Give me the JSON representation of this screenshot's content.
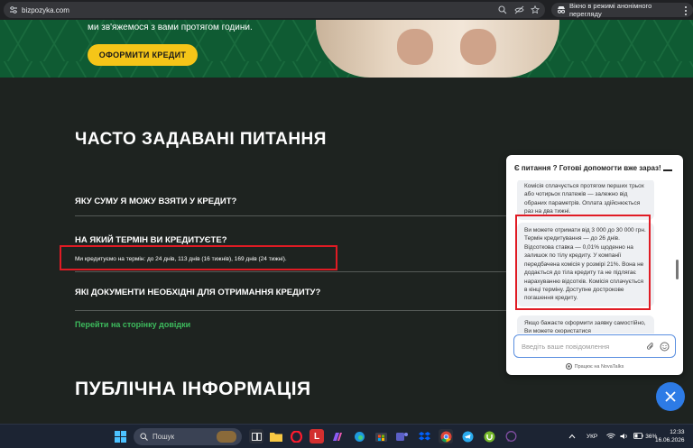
{
  "browser": {
    "url": "bizpozyka.com",
    "incognito_label": "Вікно в режимі анонімного перегляду"
  },
  "hero": {
    "text": "ми зв'яжемося з вами протягом години.",
    "cta_label": "ОФОРМИТИ КРЕДИТ"
  },
  "faq": {
    "title": "ЧАСТО ЗАДАВАНІ ПИТАННЯ",
    "questions": [
      {
        "label": "ЯКУ СУМУ Я МОЖУ ВЗЯТИ У КРЕДИТ?"
      },
      {
        "label": "НА ЯКИЙ ТЕРМІН ВИ КРЕДИТУЄТЕ?",
        "answer": "Ми кредитуємо на термін: до 24 днів, 113 днів (16 тижнів), 169 днів (24 тижні)."
      },
      {
        "label": "ЯКІ ДОКУМЕНТИ НЕОБХІДНІ ДЛЯ ОТРИМАННЯ КРЕДИТУ?"
      }
    ],
    "help_link": "Перейти на сторінку довідки"
  },
  "public_info": {
    "title": "ПУБЛІЧНА ІНФОРМАЦІЯ"
  },
  "chat": {
    "header": "Є питання ? Готові допомогти вже зараз!",
    "messages": [
      "Комісія сплачується протягом перших трьох або чотирьох платежів — залежно від обраних параметрів. Оплата здійснюється раз на два тижні.",
      "Ви можете отримати від 3 000 до 30 000 грн. Термін кредитування — до 26 днів. Відсоткова ставка — 0,01% щоденно на залишок по тілу кредиту. У компанії передбачена комісія у розмірі 21%. Вона не додається до тіла кредиту та не підлягає нарахуванню відсотків. Комісія сплачується в кінці терміну. Доступне дострокове погашення кредиту.",
      "Якщо бажаєте оформити заявку самостійно, Ви можете скористатися"
    ],
    "input_placeholder": "Введіть ваше повідомлення",
    "footer": "Працює на NovaTalks"
  },
  "taskbar": {
    "search_placeholder": "Пошук",
    "language": "УКР",
    "battery": "36%",
    "time": "12:33",
    "date": "16.06.2026"
  }
}
